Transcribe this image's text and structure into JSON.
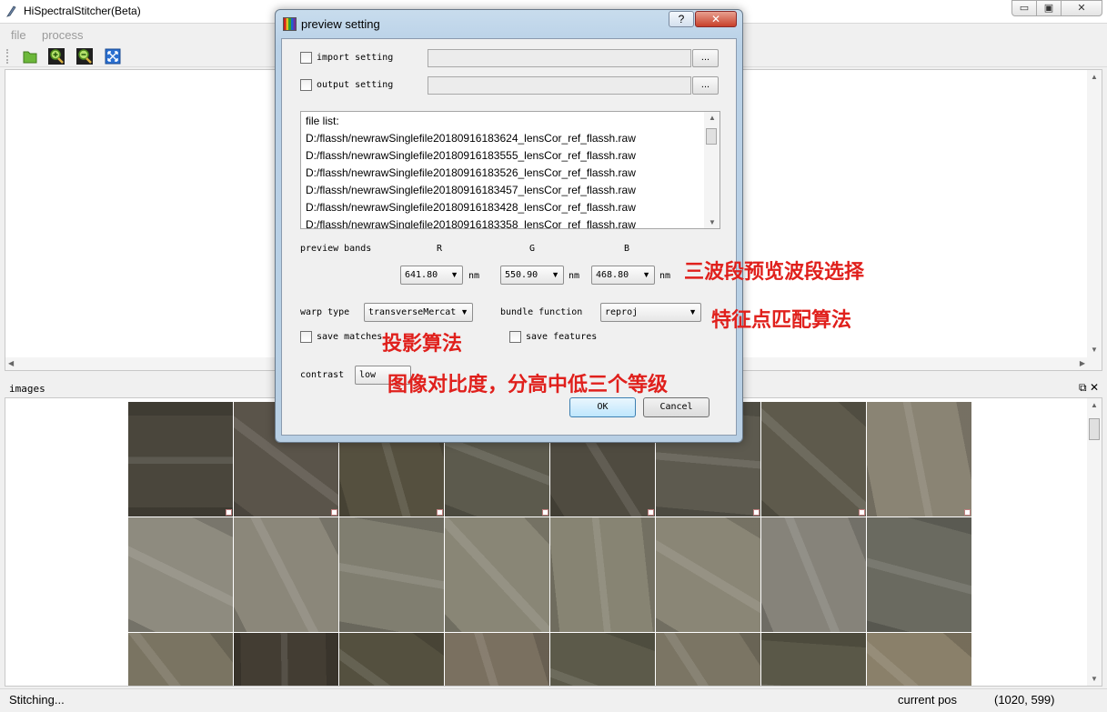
{
  "window": {
    "title": "HiSpectralStitcher(Beta)",
    "controls": {
      "minimize": "▭",
      "maximize": "▣",
      "close": "✕"
    }
  },
  "menu": {
    "items": [
      "file",
      "process"
    ]
  },
  "toolbar": {
    "icons": [
      "open-folder-icon",
      "zoom-in-icon",
      "zoom-out-icon",
      "fit-view-icon"
    ]
  },
  "dock": {
    "title": "images",
    "float": "⧉",
    "close": "✕"
  },
  "status": {
    "left": "Stitching...",
    "pos_label": "current pos",
    "pos_value": "(1020, 599)"
  },
  "dialog": {
    "title": "preview setting",
    "help": "?",
    "close": "✕",
    "import_label": "import setting",
    "output_label": "output setting",
    "browse": "...",
    "file_list": [
      "file list:",
      "D:/flassh/newrawSinglefile20180916183624_lensCor_ref_flassh.raw",
      "D:/flassh/newrawSinglefile20180916183555_lensCor_ref_flassh.raw",
      "D:/flassh/newrawSinglefile20180916183526_lensCor_ref_flassh.raw",
      "D:/flassh/newrawSinglefile20180916183457_lensCor_ref_flassh.raw",
      "D:/flassh/newrawSinglefile20180916183428_lensCor_ref_flassh.raw",
      "D:/flassh/newrawSinglefile20180916183358_lensCor_ref_flassh.raw"
    ],
    "preview_bands_label": "preview bands",
    "bands": [
      {
        "channel": "R",
        "value": "641.80",
        "unit": "nm"
      },
      {
        "channel": "G",
        "value": "550.90",
        "unit": "nm"
      },
      {
        "channel": "B",
        "value": "468.80",
        "unit": "nm"
      }
    ],
    "warp_type_label": "warp type",
    "warp_type_value": "transverseMercat",
    "bundle_label": "bundle function",
    "bundle_value": "reproj",
    "save_matches_label": "save matches",
    "save_features_label": "save features",
    "contrast_label": "contrast",
    "contrast_value": "low",
    "ok": "OK",
    "cancel": "Cancel"
  },
  "annotations": {
    "bands": "三波段预览波段选择",
    "features": "特征点匹配算法",
    "projection": "投影算法",
    "contrast": "图像对比度，分高中低三个等级"
  },
  "thumbnails": {
    "colors": [
      "#4a463c",
      "#5a544a",
      "#55503f",
      "#5c5a4d",
      "#4f4b40",
      "#5d5a4f",
      "#5e5a4c",
      "#8a8474",
      "#8e8b7f",
      "#8b877a",
      "#807e70",
      "#898676",
      "#878473",
      "#8a8676",
      "#86837a",
      "#6a6a60",
      "#7a7462",
      "#433d33",
      "#54503f",
      "#7a7060",
      "#5c5a4a",
      "#7b7564",
      "#5a5848",
      "#8a806a"
    ]
  },
  "colors": {
    "annotation": "#e0201c",
    "dialog_frame": "#b9d1e7"
  }
}
